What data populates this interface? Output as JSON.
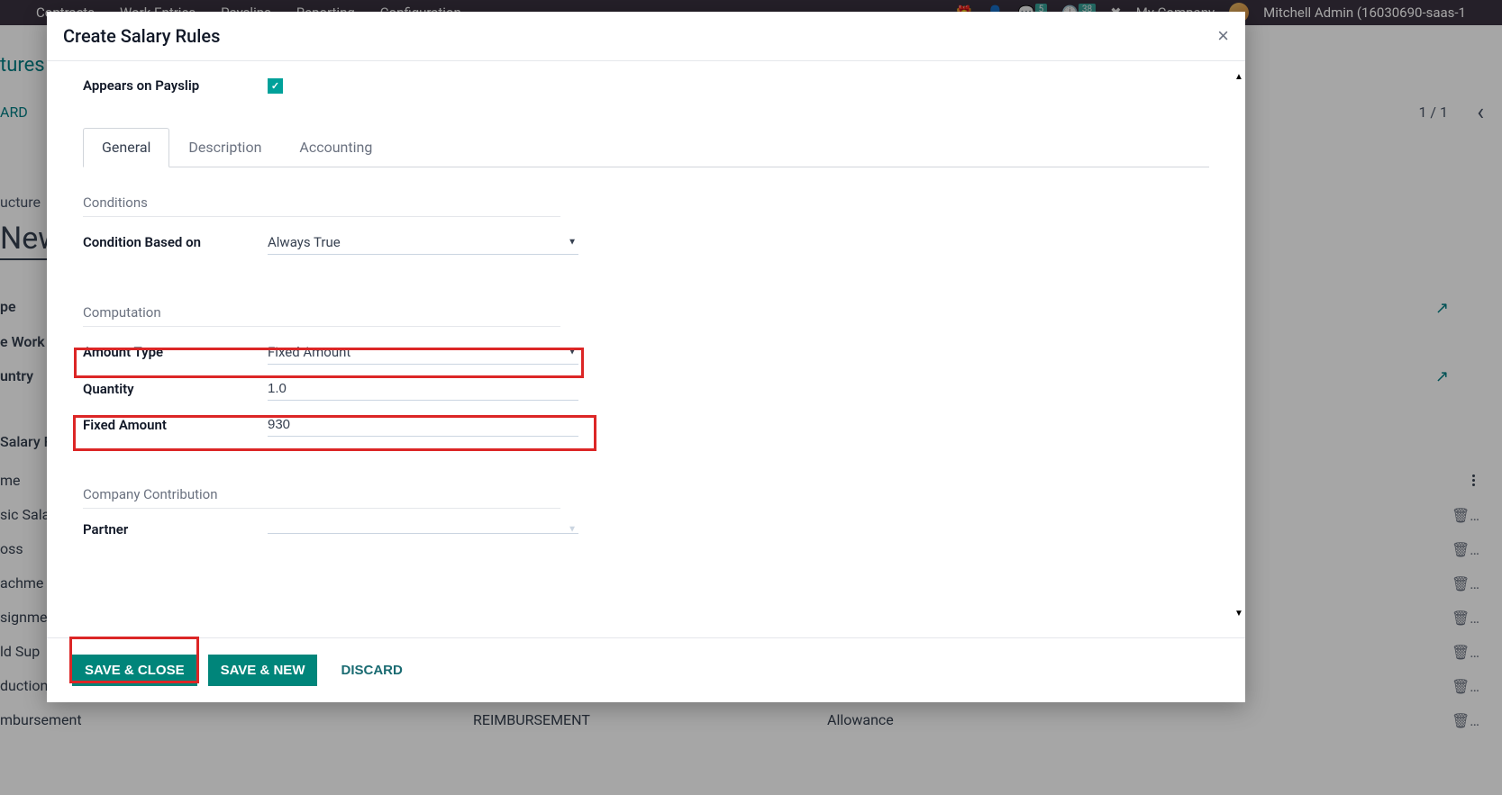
{
  "topNav": {
    "items": [
      "Contracts",
      "Work Entries",
      "Payslips",
      "Reporting",
      "Configuration"
    ],
    "badge1": "5",
    "badge2": "38",
    "company": "My Company",
    "user": "Mitchell Admin (16030690-saas-1"
  },
  "background": {
    "breadcrumb1": "tures",
    "breadcrumb2": "ARD",
    "pager": "1 / 1",
    "leftLabels": [
      "ucture",
      "New",
      "pe",
      "e Work",
      "untry",
      "Salary R",
      "me",
      "sic Sala",
      "oss",
      "achme",
      "signme",
      "ld Sup",
      "duction",
      "mbursement"
    ],
    "bottomRow": {
      "code": "REIMBURSEMENT",
      "category": "Allowance"
    }
  },
  "modal": {
    "title": "Create Salary Rules",
    "appearsLabel": "Appears on Payslip",
    "appearsChecked": true,
    "tabs": [
      "General",
      "Description",
      "Accounting"
    ],
    "activeTab": 0,
    "sections": {
      "conditions": {
        "title": "Conditions",
        "fields": {
          "conditionBasedOn": {
            "label": "Condition Based on",
            "value": "Always True"
          }
        }
      },
      "computation": {
        "title": "Computation",
        "fields": {
          "amountType": {
            "label": "Amount Type",
            "value": "Fixed Amount"
          },
          "quantity": {
            "label": "Quantity",
            "value": "1.0"
          },
          "fixedAmount": {
            "label": "Fixed Amount",
            "value": "930"
          }
        }
      },
      "companyContribution": {
        "title": "Company Contribution",
        "fields": {
          "partner": {
            "label": "Partner",
            "value": ""
          }
        }
      }
    }
  },
  "footer": {
    "saveClose": "SAVE & CLOSE",
    "saveNew": "SAVE & NEW",
    "discard": "DISCARD"
  }
}
